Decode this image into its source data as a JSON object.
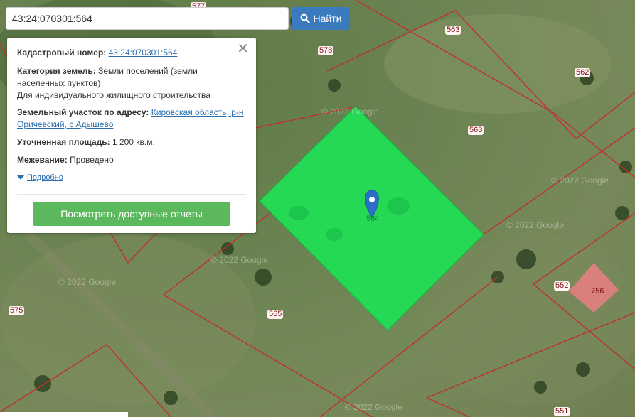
{
  "search": {
    "value": "43:24:070301:564",
    "button_label": "Найти"
  },
  "info": {
    "cadastral_label": "Кадастровый номер:",
    "cadastral_value": "43:24:070301:564",
    "category_label": "Категория земель:",
    "category_value": "Земли поселений (земли населенных пунктов)",
    "category_use": "Для индивидуального жилищного строительства",
    "address_label": "Земельный участок по адресу:",
    "address_value": "Кировская область, р-н Оричевский, с Адышево",
    "area_label": "Уточненная площадь:",
    "area_value": "1 200 кв.м.",
    "survey_label": "Межевание:",
    "survey_value": "Проведено",
    "more_label": "Подробно",
    "report_button": "Посмотреть доступные отчеты"
  },
  "map": {
    "plots": [
      "577",
      "578",
      "563",
      "562",
      "563",
      "564",
      "565",
      "575",
      "552",
      "756",
      "551"
    ],
    "watermark": "© 2022 Google",
    "selected_fill": "#22dd55",
    "boundary_color": "#c0302a",
    "highlight_fill": "#e28080"
  }
}
